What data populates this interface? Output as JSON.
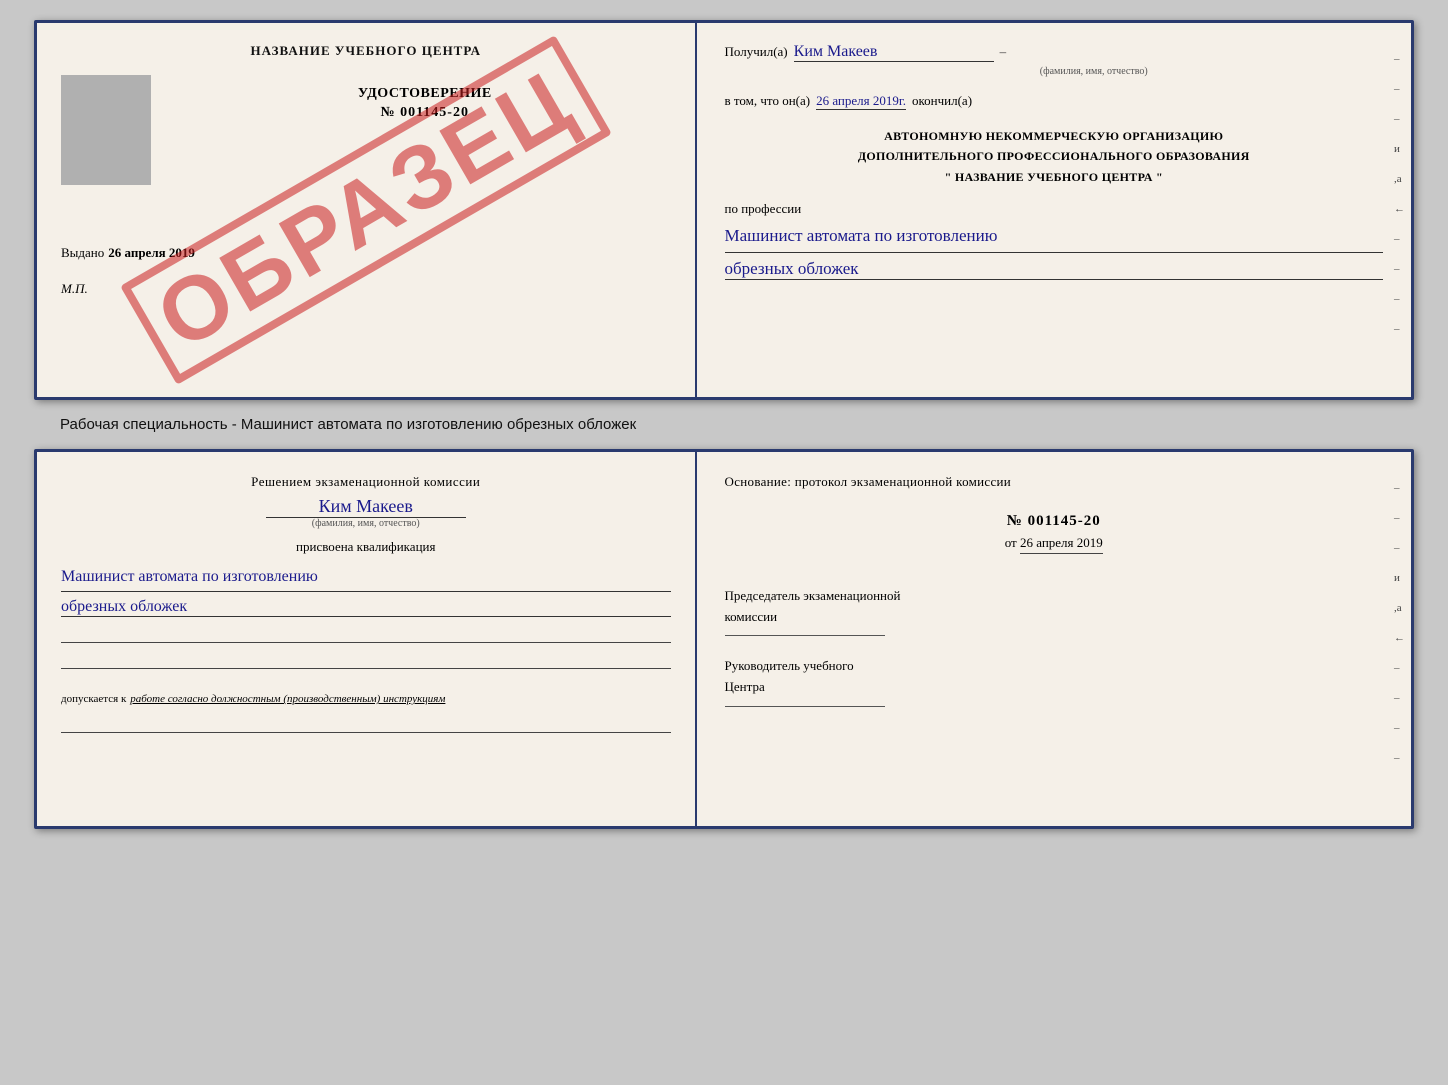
{
  "top_doc": {
    "left": {
      "center_title": "НАЗВАНИЕ УЧЕБНОГО ЦЕНТРА",
      "cert_label": "УДОСТОВЕРЕНИЕ",
      "cert_number": "№ 001145-20",
      "issued_label": "Выдано",
      "issued_date": "26 апреля 2019",
      "mp": "М.П.",
      "watermark": "ОБРАЗЕЦ"
    },
    "right": {
      "received_label": "Получил(а)",
      "recipient_name": "Ким Макеев",
      "fio_label": "(фамилия, имя, отчество)",
      "dash": "–",
      "in_that": "в том, что он(а)",
      "date_finished": "26 апреля 2019г.",
      "finished_label": "окончил(а)",
      "org_line1": "АВТОНОМНУЮ НЕКОММЕРЧЕСКУЮ ОРГАНИЗАЦИЮ",
      "org_line2": "ДОПОЛНИТЕЛЬНОГО ПРОФЕССИОНАЛЬНОГО ОБРАЗОВАНИЯ",
      "org_line3": "\"  НАЗВАНИЕ УЧЕБНОГО ЦЕНТРА  \"",
      "by_profession": "по профессии",
      "profession_line1": "Машинист автомата по изготовлению",
      "profession_line2": "обрезных обложек",
      "side_dashes": [
        "–",
        "–",
        "–",
        "и",
        ",а",
        "←",
        "–",
        "–",
        "–",
        "–"
      ]
    }
  },
  "caption": "Рабочая специальность - Машинист автомата по изготовлению обрезных обложек",
  "bottom_doc": {
    "left": {
      "resolution_line1": "Решением  экзаменационной  комиссии",
      "person_name": "Ким Макеев",
      "fio_label": "(фамилия, имя, отчество)",
      "qualification_label": "присвоена квалификация",
      "qual_line1": "Машинист автомата по изготовлению",
      "qual_line2": "обрезных обложек",
      "allowed_prefix": "допускается к",
      "allowed_italic": "работе согласно должностным (производственным) инструкциям"
    },
    "right": {
      "basis_label": "Основание: протокол экзаменационной  комиссии",
      "protocol_number": "№  001145-20",
      "from_label": "от",
      "from_date": "26 апреля 2019",
      "chairman_label1": "Председатель экзаменационной",
      "chairman_label2": "комиссии",
      "director_label1": "Руководитель учебного",
      "director_label2": "Центра",
      "side_dashes": [
        "–",
        "–",
        "–",
        "и",
        ",а",
        "←",
        "–",
        "–",
        "–",
        "–"
      ]
    }
  }
}
